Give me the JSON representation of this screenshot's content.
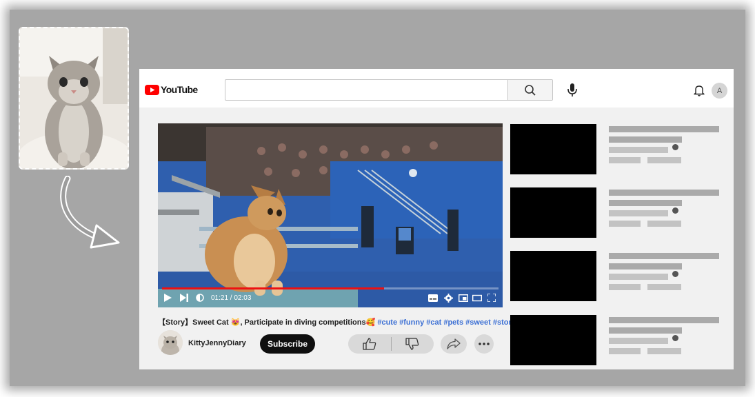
{
  "app": {
    "logo_text": "YouTube"
  },
  "search": {
    "value": "",
    "placeholder": ""
  },
  "user": {
    "avatar_initial": "A"
  },
  "player": {
    "time_current": "01:21",
    "time_total": "02:03",
    "progress": 0.66
  },
  "video": {
    "title_text": "【Story】Sweet Cat 😻, Participate in diving competitions🥰 ",
    "hashtags": "#cute #funny #cat #pets #sweet #story",
    "channel": "KittyJennyDiary",
    "subscribe_label": "Subscribe"
  },
  "recommendations_count": 4,
  "colors": {
    "brand_red": "#ff0000",
    "hashtag_blue": "#3b6fd4",
    "subscribe_bg": "#0f0f0f"
  },
  "icons": [
    "youtube-logo-icon",
    "search-icon",
    "microphone-icon",
    "bell-icon",
    "play-icon",
    "next-icon",
    "volume-icon",
    "subtitles-icon",
    "settings-icon",
    "miniplayer-icon",
    "theater-icon",
    "fullscreen-icon",
    "thumbs-up-icon",
    "thumbs-down-icon",
    "share-icon",
    "more-icon",
    "verified-icon",
    "curved-arrow-icon"
  ]
}
